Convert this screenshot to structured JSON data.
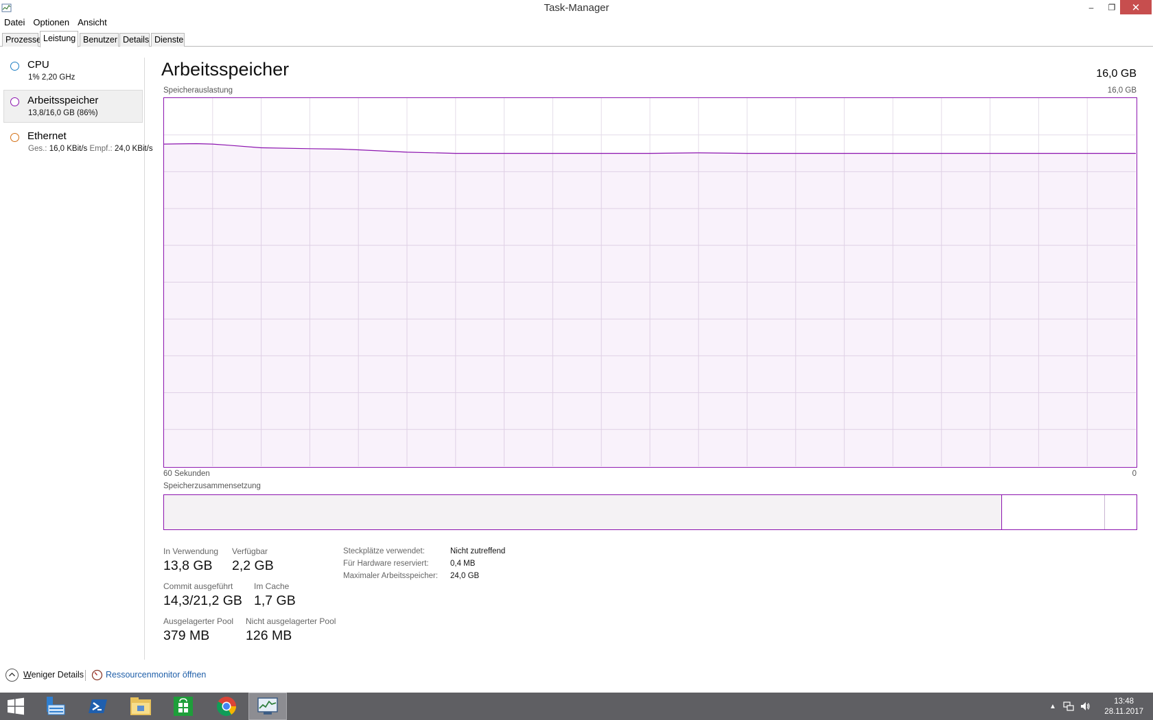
{
  "window": {
    "title": "Task-Manager",
    "minimize_glyph": "–",
    "maximize_glyph": "❐",
    "close_glyph": "✕"
  },
  "menu": [
    "Datei",
    "Optionen",
    "Ansicht"
  ],
  "tabs": [
    "Prozesse",
    "Leistung",
    "Benutzer",
    "Details",
    "Dienste"
  ],
  "active_tab": "Leistung",
  "sidebar": {
    "items": [
      {
        "name": "CPU",
        "detail": "1% 2,20 GHz",
        "color": "#1b7dc2"
      },
      {
        "name": "Arbeitsspeicher",
        "detail": "13,8/16,0 GB (86%)",
        "color": "#8b12ae"
      },
      {
        "name": "Ethernet",
        "detail_send_label": "Ges.:",
        "detail_send": "16,0 KBit/s",
        "detail_recv_label": "Empf.:",
        "detail_recv": "24,0 KBit/s",
        "color": "#d36e12"
      }
    ],
    "selected": "Arbeitsspeicher"
  },
  "main": {
    "title": "Arbeitsspeicher",
    "total": "16,0 GB",
    "usage_label": "Speicherauslastung",
    "usage_max": "16,0 GB",
    "axis_left": "60 Sekunden",
    "axis_right": "0",
    "composition_label": "Speicherzusammensetzung"
  },
  "stats": {
    "in_use_label": "In Verwendung",
    "in_use": "13,8 GB",
    "available_label": "Verfügbar",
    "available": "2,2 GB",
    "committed_label": "Commit ausgeführt",
    "committed": "14,3/21,2 GB",
    "cached_label": "Im Cache",
    "cached": "1,7 GB",
    "paged_label": "Ausgelagerter Pool",
    "paged": "379 MB",
    "nonpaged_label": "Nicht ausgelagerter Pool",
    "nonpaged": "126 MB"
  },
  "properties": [
    {
      "key": "Steckplätze verwendet:",
      "value": "Nicht zutreffend"
    },
    {
      "key": "Für Hardware reserviert:",
      "value": "0,4 MB"
    },
    {
      "key": "Maximaler Arbeitsspeicher:",
      "value": "24,0 GB"
    }
  ],
  "footer": {
    "less_details_underlined": "W",
    "less_details_rest": "eniger Details",
    "resource_monitor": "Ressourcenmonitor öffnen"
  },
  "taskbar": {
    "apps": [
      "start-icon",
      "server-manager-icon",
      "powershell-icon",
      "file-explorer-icon",
      "store-icon",
      "chrome-icon",
      "task-manager-icon"
    ],
    "active_app": "task-manager-icon",
    "clock_time": "13:48",
    "clock_date": "28.11.2017"
  },
  "chart_data": {
    "type": "area",
    "title": "Speicherauslastung",
    "x_range_seconds": [
      60,
      0
    ],
    "ylim_gb": [
      0,
      16
    ],
    "grid": true,
    "x": [
      60,
      58,
      57,
      56,
      54,
      51,
      49,
      48,
      45,
      42,
      36,
      30,
      27,
      24,
      18,
      15,
      12,
      9,
      6,
      3,
      0
    ],
    "values": [
      14.0,
      14.02,
      14.0,
      13.95,
      13.84,
      13.8,
      13.78,
      13.75,
      13.65,
      13.6,
      13.6,
      13.6,
      13.62,
      13.6,
      13.6,
      13.6,
      13.6,
      13.6,
      13.6,
      13.6,
      13.6
    ],
    "composition": {
      "in_use_gb": 13.8,
      "standby_gb": 1.7,
      "free_gb": 0.5,
      "total_gb": 16.0
    },
    "accent_color": "#8b12ae"
  }
}
